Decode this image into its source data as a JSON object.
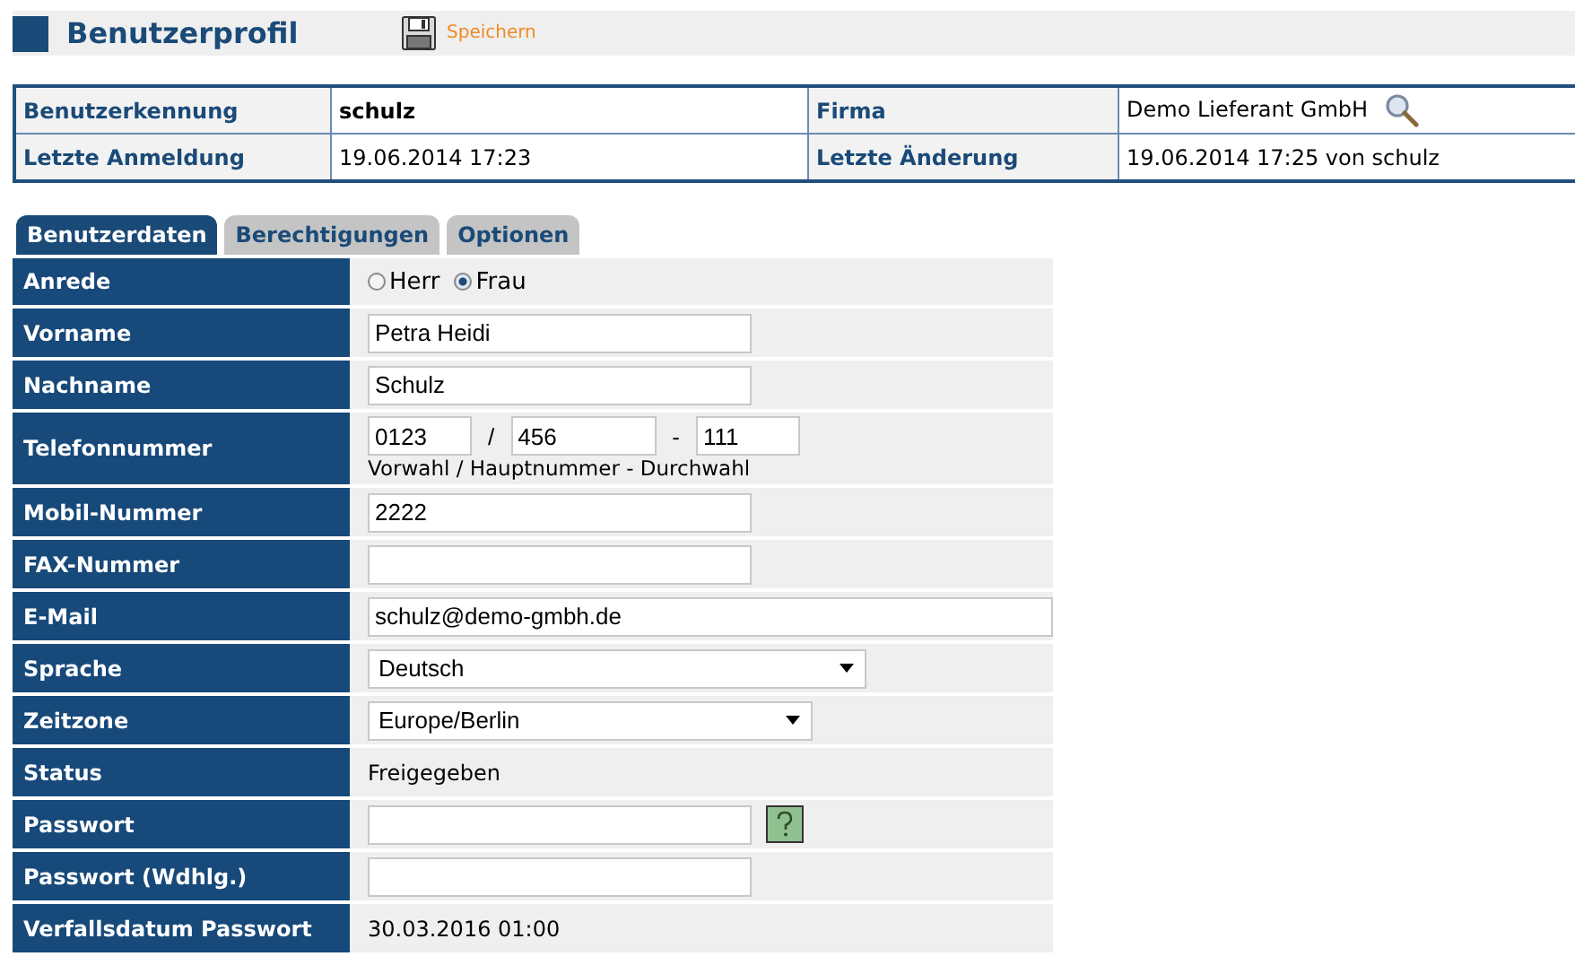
{
  "page_title": "Benutzerprofil",
  "save_label": "Speichern",
  "info": [
    {
      "label": "Benutzerkennung",
      "value": "schulz",
      "bold": true,
      "label2": "Firma",
      "value2": "Demo Lieferant GmbH",
      "lookup": true
    },
    {
      "label": "Letzte Anmeldung",
      "value": "19.06.2014 17:23",
      "bold": false,
      "label2": "Letzte Änderung",
      "value2": "19.06.2014 17:25 von schulz",
      "lookup": false
    }
  ],
  "tabs": [
    {
      "label": "Benutzerdaten",
      "selected": true
    },
    {
      "label": "Berechtigungen",
      "selected": false
    },
    {
      "label": "Optionen",
      "selected": false
    }
  ],
  "rows": [
    {
      "kind": "radio",
      "label": "Anrede",
      "options": [
        {
          "label": "Herr",
          "selected": false
        },
        {
          "label": "Frau",
          "selected": true
        }
      ]
    },
    {
      "kind": "text",
      "label": "Vorname",
      "value": "Petra Heidi"
    },
    {
      "kind": "text",
      "label": "Nachname",
      "value": "Schulz"
    },
    {
      "kind": "phone",
      "label": "Telefonnummer",
      "parts": [
        "0123",
        "456",
        "111"
      ],
      "separators": [
        "/",
        "-"
      ],
      "hint": "Vorwahl / Hauptnummer - Durchwahl"
    },
    {
      "kind": "text",
      "label": "Mobil-Nummer",
      "value": "2222"
    },
    {
      "kind": "text",
      "label": "FAX-Nummer"
    },
    {
      "kind": "wide",
      "label": "E-Mail",
      "value": "schulz@demo-gmbh.de"
    },
    {
      "kind": "select",
      "label": "Sprache",
      "value": "Deutsch"
    },
    {
      "kind": "select",
      "label": "Zeitzone",
      "value": "Europe/Berlin"
    },
    {
      "kind": "static",
      "label": "Status",
      "value": "Freigegeben"
    },
    {
      "kind": "password",
      "label": "Passwort",
      "help": true
    },
    {
      "kind": "password",
      "label": "Passwort (Wdhlg.)",
      "help": false
    },
    {
      "kind": "static",
      "label": "Verfallsdatum Passwort",
      "value": "30.03.2016 01:00"
    }
  ]
}
